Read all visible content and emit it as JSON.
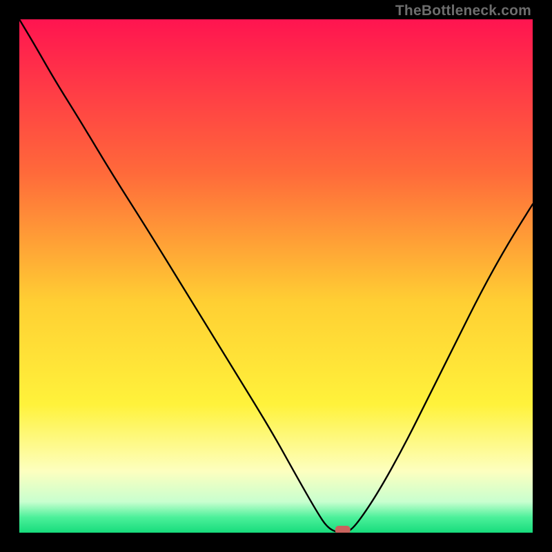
{
  "attribution": "TheBottleneck.com",
  "chart_data": {
    "type": "line",
    "title": "",
    "xlabel": "",
    "ylabel": "",
    "xlim": [
      0,
      100
    ],
    "ylim": [
      0,
      100
    ],
    "series": [
      {
        "name": "bottleneck-curve",
        "x": [
          0,
          3,
          7,
          12,
          18,
          25,
          33,
          41,
          49,
          54,
          58,
          60,
          62,
          64,
          66,
          70,
          75,
          80,
          85,
          90,
          95,
          100
        ],
        "y": [
          100,
          95,
          88,
          80,
          70,
          59,
          46,
          33,
          20,
          11,
          4,
          1,
          0,
          0,
          2,
          8,
          17,
          27,
          37,
          47,
          56,
          64
        ]
      }
    ],
    "marker": {
      "x": 63,
      "y": 0,
      "label": "optimal-point"
    },
    "gradient_stops": [
      {
        "offset": 0,
        "color": "#ff1450"
      },
      {
        "offset": 30,
        "color": "#ff6a3a"
      },
      {
        "offset": 55,
        "color": "#ffcf33"
      },
      {
        "offset": 75,
        "color": "#fff23b"
      },
      {
        "offset": 88,
        "color": "#fdffbf"
      },
      {
        "offset": 94,
        "color": "#c8ffcf"
      },
      {
        "offset": 97,
        "color": "#4cf09a"
      },
      {
        "offset": 100,
        "color": "#17dc7c"
      }
    ]
  }
}
